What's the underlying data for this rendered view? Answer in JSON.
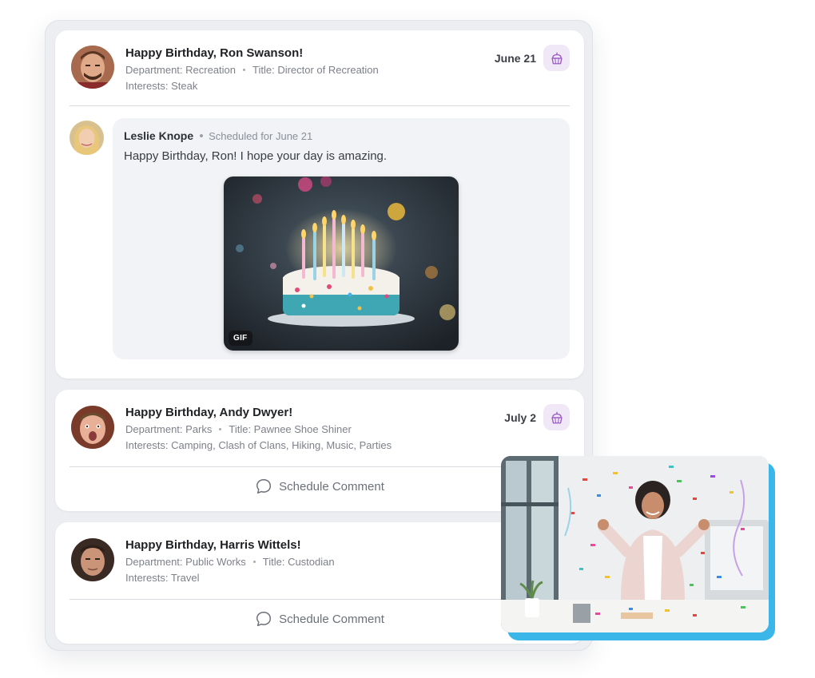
{
  "cards": [
    {
      "name": "Happy Birthday, Ron Swanson!",
      "department": "Department: Recreation",
      "title": "Title: Director of Recreation",
      "interests": "Interests: Steak",
      "date": "June 21"
    },
    {
      "name": "Happy Birthday, Andy Dwyer!",
      "department": "Department: Parks",
      "title": "Title: Pawnee Shoe Shiner",
      "interests": "Interests: Camping, Clash of Clans, Hiking, Music, Parties",
      "date": "July 2",
      "action": "Schedule Comment"
    },
    {
      "name": "Happy Birthday, Harris Wittels!",
      "department": "Department: Public Works",
      "title": "Title: Custodian",
      "interests": "Interests: Travel",
      "action": "Schedule Comment"
    }
  ],
  "comment": {
    "author": "Leslie Knope",
    "scheduled": "Scheduled for June 21",
    "message": "Happy Birthday, Ron! I hope your day is amazing.",
    "gif_label": "GIF"
  },
  "icons": {
    "badge": "cupcake-icon",
    "action": "speech-bubble-icon"
  },
  "colors": {
    "accent": "#9b59c6",
    "badge_bg": "#f1e8f7",
    "photo_frame": "#3bb6e8"
  }
}
